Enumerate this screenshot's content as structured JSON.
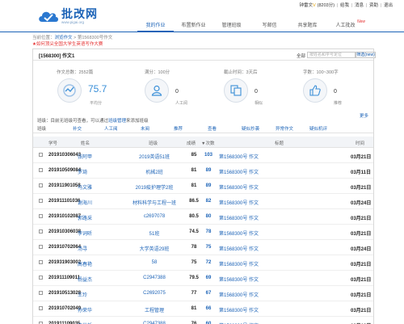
{
  "header": {
    "brand": "批改网",
    "brand_url": "www.pigai.org",
    "user": {
      "name": "钟雷文",
      "vip": "V",
      "points": "(8203分)",
      "links": [
        "给我",
        "消息",
        "资助",
        "退出"
      ]
    }
  },
  "nav": {
    "items": [
      {
        "label": "我的作业",
        "active": true
      },
      {
        "label": "布置新作业",
        "active": false
      },
      {
        "label": "管理班级",
        "active": false
      },
      {
        "label": "写邮信",
        "active": false
      },
      {
        "label": "共享题库",
        "active": false
      },
      {
        "label": "人工批改",
        "active": false,
        "badge": "New"
      }
    ]
  },
  "breadcrumb": {
    "prefix": "当前位置：",
    "link": "浏览作文",
    "sep": " > ",
    "current": "第1568300号作文"
  },
  "notice": "★如何顶尖全国大学生英语写作大赛",
  "panel": {
    "title": "[1568300] 作文1",
    "search_label": "全部",
    "search_placeholder": "按姓名和学号定位",
    "filter_label": "筛选(new)"
  },
  "stats": {
    "total": "作文总数：2552篇",
    "full": "满分：100分",
    "deadline": "截止时间：3天后",
    "words": "字数：100~300字"
  },
  "gauges": [
    {
      "value": "75.7",
      "sub": "平均分",
      "icon": "average-icon"
    },
    {
      "value": "0",
      "sub": "人工阅",
      "icon": "person-icon"
    },
    {
      "value": "0",
      "sub": "相似",
      "icon": "similar-icon"
    },
    {
      "value": "0",
      "sub": "推荐",
      "icon": "recommend-icon"
    }
  ],
  "more_label": "更多",
  "class_row": {
    "label": "班级：",
    "text1": "目前无班级可查看，可以通过",
    "link": "班级管理",
    "text2": "来添加班级"
  },
  "tabs": [
    {
      "label": "班级",
      "style": "plain"
    },
    {
      "label": "补交",
      "style": "link"
    },
    {
      "label": "人工阅",
      "style": "link"
    },
    {
      "label": "未阅",
      "style": "link"
    },
    {
      "label": "推荐",
      "style": "link"
    },
    {
      "label": "查看",
      "style": "link"
    },
    {
      "label": "疑似抄袭",
      "style": "link"
    },
    {
      "label": "异常作文",
      "style": "link"
    },
    {
      "label": "疑似机评",
      "style": "link"
    }
  ],
  "table": {
    "headers": [
      "学号",
      "姓名",
      "班级",
      "成绩",
      "▼次数",
      "标题",
      "时间"
    ],
    "rows": [
      {
        "id": "201910306043",
        "name": "张阿甲",
        "cls": "2019英语51班",
        "score": "85",
        "count": "103",
        "title": "第1568300号 作文",
        "date": "03月21日"
      },
      {
        "id": "201910509084",
        "name": "罗琦",
        "cls": "机械2班",
        "score": "81",
        "count": "89",
        "title": "第1568300号 作文",
        "date": "03月11日"
      },
      {
        "id": "201911901058",
        "name": "马文雅",
        "cls": "2019疫护理学2班",
        "score": "81",
        "count": "89",
        "title": "第1568300号 作文",
        "date": "03月21日"
      },
      {
        "id": "201911101036",
        "name": "谢海川",
        "cls": "材料科学与工程一班",
        "score": "86.5",
        "count": "82",
        "title": "第1568300号 作文",
        "date": "03月24日"
      },
      {
        "id": "201910102087",
        "name": "郭路采",
        "cls": "c2697078",
        "score": "80.5",
        "count": "80",
        "title": "第1568300号 作文",
        "date": "03月21日"
      },
      {
        "id": "201910306038",
        "name": "李词听",
        "cls": "51班",
        "score": "74.5",
        "count": "78",
        "title": "第1568300号 作文",
        "date": "03月21日"
      },
      {
        "id": "201910702064",
        "name": "汤寻",
        "cls": "大学英语29班",
        "score": "78",
        "count": "75",
        "title": "第1568300号 作文",
        "date": "03月24日"
      },
      {
        "id": "201931903002",
        "name": "高春艳",
        "cls": "58",
        "score": "75",
        "count": "72",
        "title": "第1568300号 作文",
        "date": "03月21日"
      },
      {
        "id": "201911109011",
        "name": "杨益杰",
        "cls": "C2947388",
        "score": "79.5",
        "count": "69",
        "title": "第1568300号 作文",
        "date": "03月21日"
      },
      {
        "id": "201910513028",
        "name": "王玲",
        "cls": "C2692075",
        "score": "77",
        "count": "67",
        "title": "第1568300号 作文",
        "date": "03月21日"
      },
      {
        "id": "201910702049",
        "name": "孙荣华",
        "cls": "工程管理",
        "score": "81",
        "count": "66",
        "title": "第1568300号 作文",
        "date": "03月21日"
      },
      {
        "id": "201911109035",
        "name": "康世哲",
        "cls": "C2947388",
        "score": "76",
        "count": "60",
        "title": "第1568300号 作文",
        "date": "03月19日"
      }
    ]
  },
  "colors": {
    "accent": "#1c63b7",
    "gauge": "#3a8fd8",
    "alert": "#e52f2f"
  }
}
